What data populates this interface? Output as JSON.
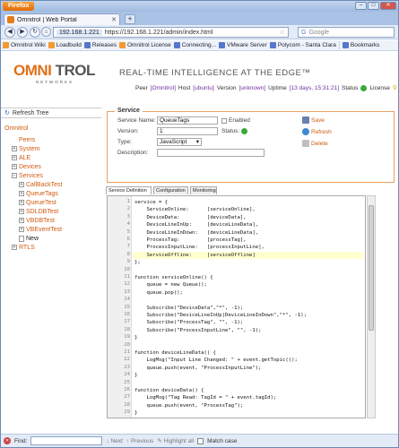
{
  "browser": {
    "app_menu": "Firefox",
    "tab_title": "Omnitrol | Web Portal",
    "new_tab": "+",
    "url_site": "192.168.1.221",
    "url": "https://192.168.1.221/admin/index.html",
    "search_placeholder": "Google",
    "bookmarks": [
      "Omnitrol Wiki",
      "Loadbuild",
      "Releases",
      "Omnitrol License",
      "Connecting...",
      "VMware Server",
      "Polycom - Santa Clara",
      "Bookmarks"
    ]
  },
  "header": {
    "logo_a": "OMNI",
    "logo_b": "TROL",
    "logo_sub": "NETWORKS",
    "tagline": "REAL-TIME INTELLIGENCE AT THE EDGE™",
    "peer_label": "Peer",
    "peer_value": "[Omnitrol]",
    "host_label": "Host",
    "host_value": "[ubuntu]",
    "version_label": "Version",
    "version_value": "[unknown]",
    "uptime_label": "Uptime",
    "uptime_value": "[13 days, 15:31:21]",
    "status_label": "Status",
    "license_label": "License"
  },
  "sidebar": {
    "refresh": "Refresh Tree",
    "tree": [
      {
        "label": "Omnitrol",
        "level": 0,
        "type": "root"
      },
      {
        "label": "Peers",
        "level": 1,
        "type": "leaf"
      },
      {
        "label": "System",
        "level": 1,
        "type": "collapsed"
      },
      {
        "label": "ALE",
        "level": 1,
        "type": "collapsed"
      },
      {
        "label": "Devices",
        "level": 1,
        "type": "collapsed"
      },
      {
        "label": "Services",
        "level": 1,
        "type": "expanded"
      },
      {
        "label": "CallBackTest",
        "level": 2,
        "type": "collapsed"
      },
      {
        "label": "QueueTags",
        "level": 2,
        "type": "collapsed"
      },
      {
        "label": "QueueTest",
        "level": 2,
        "type": "collapsed"
      },
      {
        "label": "SDLDBTest",
        "level": 2,
        "type": "collapsed"
      },
      {
        "label": "VBDBTest",
        "level": 2,
        "type": "collapsed"
      },
      {
        "label": "VBEventTest",
        "level": 2,
        "type": "collapsed"
      },
      {
        "label": "New",
        "level": 2,
        "type": "new"
      },
      {
        "label": "RTLS",
        "level": 1,
        "type": "collapsed"
      }
    ]
  },
  "service": {
    "legend": "Service",
    "name_label": "Service Name:",
    "name_value": "QueueTags",
    "enabled_label": "Enabled",
    "version_label": "Version:",
    "version_value": "1",
    "status_label": "Status:",
    "type_label": "Type:",
    "type_value": "JavaScript",
    "description_label": "Description:",
    "description_value": "",
    "save": "Save",
    "refresh": "Refresh",
    "delete": "Delete"
  },
  "editor": {
    "tabs": [
      "Service Definition",
      "Configuration",
      "Monitoring"
    ],
    "lines": [
      "service = {",
      "    ServiceOnline:      [serviceOnline],",
      "    DeviceData:         [deviceData],",
      "    DeviceLineInUp:     [deviceLineData],",
      "    DeviceLineInDown:   [deviceLineData],",
      "    ProcessTag:         [processTag],",
      "    ProcessInputLine:   [processInputLine],",
      "    ServiceOffline:     [serviceOffline]",
      "};",
      "",
      "function serviceOnline() {",
      "    queue = new Queue();",
      "    queue.pop();",
      "",
      "    Subscribe(\"DeviceData\",\"*\", -1);",
      "    Subscribe(\"DeviceLineInUp|DeviceLineInDown\",\"*\", -1);",
      "    Subscribe(\"ProcessTag\", \"\", -1);",
      "    Subscribe(\"ProcessInputLine\", \"\", -1);",
      "}",
      "",
      "function deviceLineData() {",
      "    LogMsg(\"Input Line Changed: \" + event.getTopic());",
      "    queue.push(event, \"ProcessInputLine\");",
      "}",
      "",
      "function deviceData() {",
      "    LogMsg(\"Tag Read: TagId = \" + event.tagId);",
      "    queue.push(event, \"ProcessTag\");",
      "}"
    ],
    "current_line": 8
  },
  "findbar": {
    "label": "Find:",
    "next": "Next",
    "previous": "Previous",
    "highlight": "Highlight all",
    "match_case": "Match case"
  },
  "colors": {
    "accent": "#e07018",
    "tree_link": "#d05a10",
    "panel_border": "#e8a060"
  }
}
